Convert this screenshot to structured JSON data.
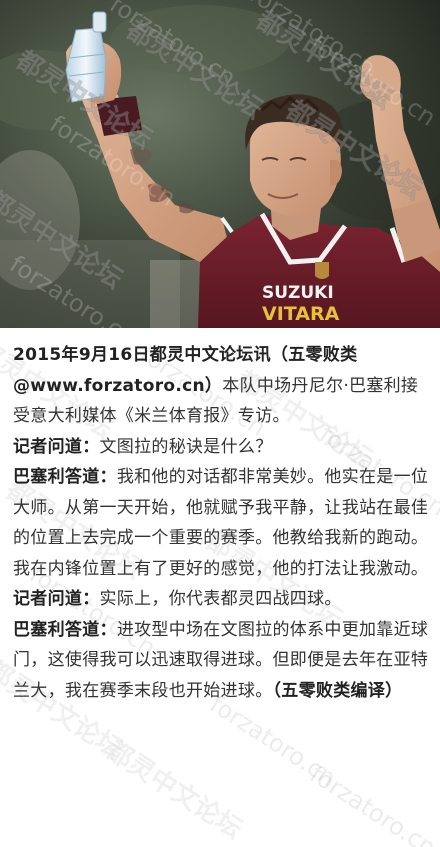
{
  "photo": {
    "jersey_sponsor_top": "SUZUKI",
    "jersey_sponsor_bottom": "VITARA"
  },
  "watermarks": {
    "cn": "都灵中文论坛",
    "url": "forzatoro.cn"
  },
  "article": {
    "intro_bold": "2015年9月16日都灵中文论坛讯（五零败类@www.forzatoro.cn）",
    "intro_text": "本队中场丹尼尔·巴塞利接受意大利媒体《米兰体育报》专访。",
    "q1_label": "记者问道：",
    "q1_text": "文图拉的秘诀是什么？",
    "a1_label": "巴塞利答道：",
    "a1_text": "我和他的对话都非常美妙。他实在是一位大师。从第一天开始，他就赋予我平静，让我站在最佳的位置上去完成一个重要的赛季。他教给我新的跑动。我在内锋位置上有了更好的感觉，他的打法让我激动。",
    "q2_label": "记者问道：",
    "q2_text": "实际上，你代表都灵四战四球。",
    "a2_label": "巴塞利答道：",
    "a2_text": "进攻型中场在文图拉的体系中更加靠近球门，这使得我可以迅速取得进球。但即便是去年在亚特兰大，我在赛季末段也开始进球。",
    "credit": "（五零败类编译）"
  },
  "colors": {
    "jersey": "#6e1f2b",
    "text": "#333333"
  }
}
